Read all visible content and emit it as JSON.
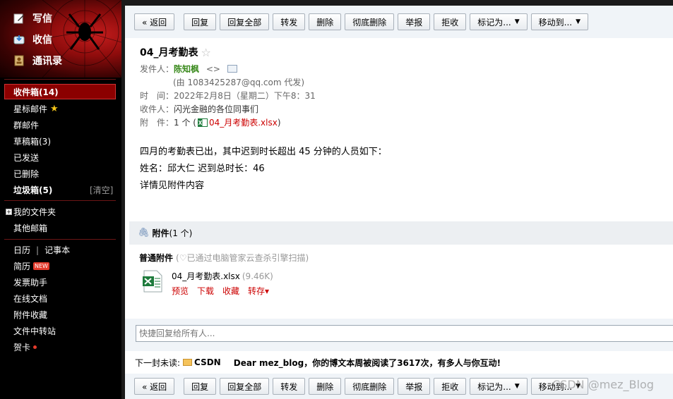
{
  "sidebar": {
    "top_actions": [
      {
        "label": "写信",
        "icon": "pencil-icon"
      },
      {
        "label": "收信",
        "icon": "inbox-receive-icon"
      },
      {
        "label": "通讯录",
        "icon": "address-book-icon"
      }
    ],
    "folders": [
      {
        "label": "收件箱(14)"
      },
      {
        "label": "星标邮件",
        "icon": "star-icon"
      },
      {
        "label": "群邮件"
      },
      {
        "label": "草稿箱(3)"
      },
      {
        "label": "已发送"
      },
      {
        "label": "已删除"
      },
      {
        "label": "垃圾箱(5)"
      }
    ],
    "clear_label": "[清空]",
    "my_folders": "我的文件夹",
    "other_mailbox": "其他邮箱",
    "calendar": "日历",
    "notebook": "记事本",
    "resume": "简历",
    "resume_badge": "NEW",
    "invoice_helper": "发票助手",
    "online_docs": "在线文档",
    "attachment_fav": "附件收藏",
    "file_transfer": "文件中转站",
    "greeting_card": "贺卡"
  },
  "toolbar": {
    "back": "« 返回",
    "reply": "回复",
    "reply_all": "回复全部",
    "forward": "转发",
    "delete": "删除",
    "delete_forever": "彻底删除",
    "report": "举报",
    "reject": "拒收",
    "mark_as": "标记为...",
    "move_to": "移动到..."
  },
  "email": {
    "subject": "04_月考勤表",
    "from_label": "发件人：",
    "from_name": "陈知枫",
    "from_brackets": "<>",
    "on_behalf": "(由 1083425287@qq.com 代发)",
    "time_label": "时　间：",
    "time_value": "2022年2月8日（星期二）下午8：31",
    "to_label": "收件人：",
    "to_value": "闪光金融的各位同事们",
    "attach_label": "附　件：",
    "attach_count": "1 个 (",
    "attach_name": "04_月考勤表.xlsx",
    "attach_close": ")",
    "body": [
      "四月的考勤表已出，其中迟到时长超出 45 分钟的人员如下：",
      "姓名：邱大仁 迟到总时长：46",
      "详情见附件内容"
    ]
  },
  "attachments": {
    "bar_title": "附件",
    "bar_count": "(1 个)",
    "section_title": "普通附件",
    "scan_note": "(♡已通过电脑管家云查杀引擎扫描)",
    "file_name": "04_月考勤表.xlsx",
    "file_size": "(9.46K)",
    "actions": [
      "预览",
      "下载",
      "收藏",
      "转存▾"
    ]
  },
  "quick_reply": {
    "placeholder": "快捷回复给所有人..."
  },
  "next_unread": {
    "label": "下一封未读:",
    "sender": "CSDN",
    "subject": "Dear mez_blog，你的博文本周被阅读了3617次，有多人与你互动!"
  },
  "watermark": "CSDN @mez_Blog",
  "colors": {
    "accent_red": "#8b0000",
    "link_red": "#cc0000",
    "sender_green": "#3a8a1d"
  }
}
